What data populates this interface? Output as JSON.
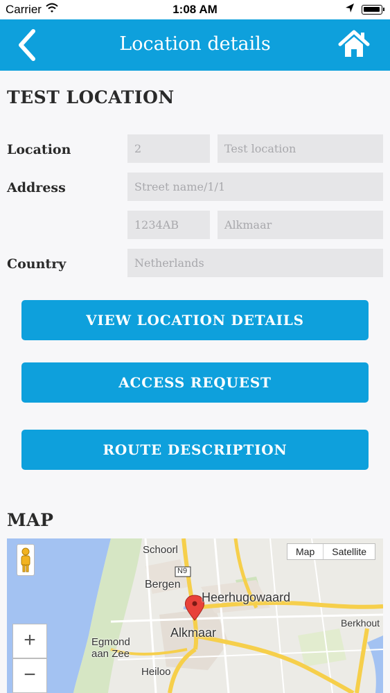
{
  "status_bar": {
    "carrier": "Carrier",
    "time": "1:08 AM"
  },
  "nav": {
    "title": "Location details"
  },
  "location_section": {
    "title": "TEST LOCATION"
  },
  "form": {
    "location_label": "Location",
    "location_number": "2",
    "location_name": "Test location",
    "address_label": "Address",
    "street": "Street name/1/1",
    "postal_code": "1234AB",
    "city": "Alkmaar",
    "country_label": "Country",
    "country": "Netherlands"
  },
  "buttons": {
    "view_details": "VIEW LOCATION DETAILS",
    "access_request": "ACCESS REQUEST",
    "route_description": "ROUTE DESCRIPTION"
  },
  "map_section": {
    "title": "MAP",
    "type_map": "Map",
    "type_satellite": "Satellite",
    "zoom_in": "+",
    "zoom_out": "−",
    "places": {
      "schoorl": "Schoorl",
      "bergen": "Bergen",
      "heerhugowaard": "Heerhugowaard",
      "alkmaar": "Alkmaar",
      "egmond": "Egmond",
      "aan_zee": "aan Zee",
      "heiloo": "Heiloo",
      "berkhout": "Berkhout",
      "road_n9": "N9"
    }
  },
  "colors": {
    "accent": "#0ea0dc",
    "field_bg": "#e6e6e8",
    "placeholder": "#a8a8ac"
  }
}
